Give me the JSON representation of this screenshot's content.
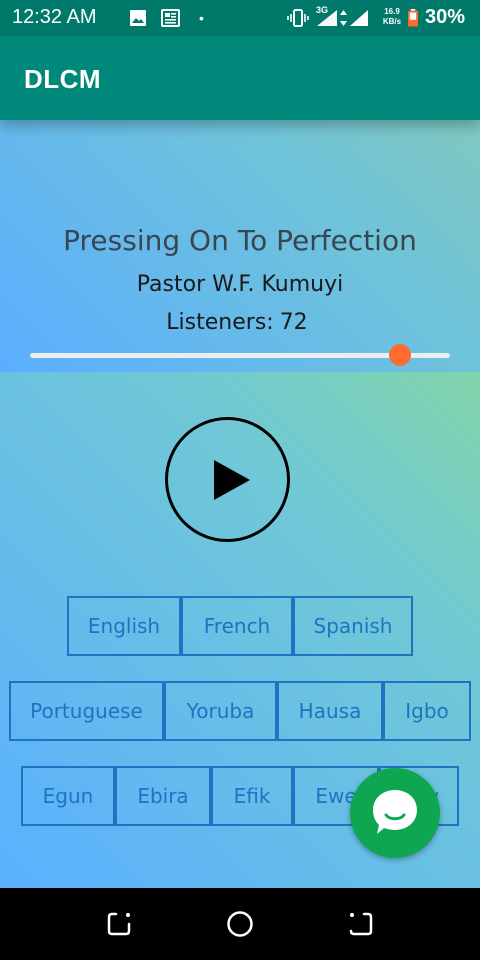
{
  "status_bar": {
    "time": "12:32 AM",
    "dot": "•",
    "network_label": "3G",
    "speed_value": "16.9",
    "speed_unit": "KB/s",
    "battery_percent": "30%"
  },
  "app_bar": {
    "title": "DLCM"
  },
  "player": {
    "track_title": "Pressing On To Perfection",
    "author": "Pastor W.F. Kumuyi",
    "listeners_label": "Listeners:",
    "listeners_count": "72",
    "progress_fraction": 0.88
  },
  "languages": {
    "row1": [
      "English",
      "French",
      "Spanish"
    ],
    "row2": [
      "Portuguese",
      "Yoruba",
      "Hausa",
      "Igbo"
    ],
    "row3": [
      "Egun",
      "Ebira",
      "Efik",
      "Ewe",
      "Ijaw"
    ]
  },
  "colors": {
    "app_bar": "#00897b",
    "status_bar": "#00796b",
    "accent_thumb": "#ff6d2e",
    "language_border": "#1f74c2",
    "chat_fab": "#0fa651"
  },
  "icons": {
    "play": "play-icon",
    "chat": "chat-bubble-icon",
    "back": "nav-back-icon",
    "home": "nav-home-icon",
    "recents": "nav-recents-icon"
  }
}
